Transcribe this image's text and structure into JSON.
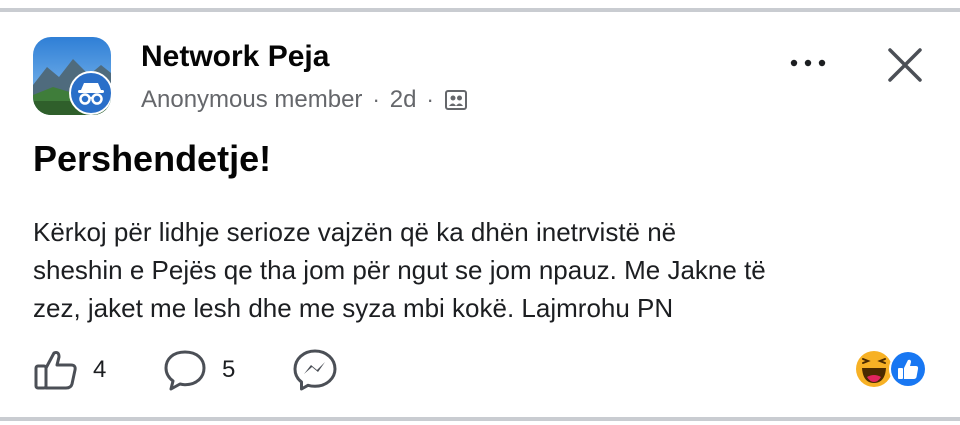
{
  "post": {
    "group_name": "Network Peja",
    "author": "Anonymous member",
    "separator": "·",
    "time": "2d",
    "title": "Pershendetje!",
    "body_lines": [
      "Kërkoj për lidhje serioze vajzën që ka dhën inetrvistë në",
      "sheshin e Pejës qe tha jom për ngut se jom npauz. Me Jakne të",
      "zez, jaket me lesh dhe me syza mbi kokë. Lajmrohu PN"
    ]
  },
  "actions": {
    "like_count": "4",
    "comment_count": "5"
  },
  "icons": {
    "more": "more-horizontal-icon",
    "close": "close-icon",
    "audience": "group-audience-icon",
    "like": "thumbs-up-icon",
    "comment": "comment-bubble-icon",
    "share": "messenger-icon",
    "reaction_haha": "haha-reaction-icon",
    "reaction_like": "like-reaction-icon"
  },
  "colors": {
    "text": "#1c1e21",
    "secondary_text": "#65676b",
    "divider": "#c9ccd1",
    "like_blue": "#1877f2",
    "haha_yellow": "#f7b125"
  }
}
